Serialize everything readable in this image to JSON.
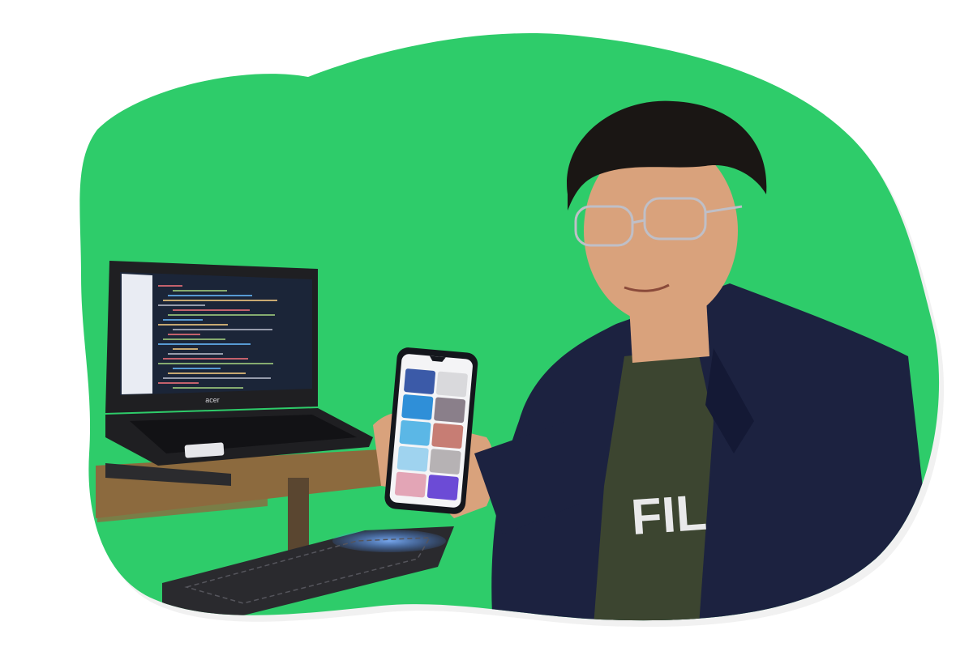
{
  "scene": {
    "background_color": "#ffffff",
    "blob_color": "#2ecc6a",
    "blob_shadow_color": "#c9c9c9"
  },
  "laptop": {
    "brand_text": "acer",
    "body_color": "#1f1f22",
    "screen_color": "#24304a",
    "editor_bg": "#1b2538",
    "code_colors": [
      "#e06c75",
      "#98c379",
      "#61afef",
      "#e5c07b",
      "#abb2bf"
    ]
  },
  "phone": {
    "frame_color": "#14161c",
    "screen_bg": "#f4f4f6",
    "gallery_tile_colors": [
      "#3b5aa8",
      "#d9d9dc",
      "#2f8fd8",
      "#8a7f8a",
      "#5bb7e6",
      "#c77d74",
      "#9fd3ef",
      "#b6b2b4",
      "#e3a5b6",
      "#6c4bd6"
    ]
  },
  "person": {
    "jacket_color": "#1c2240",
    "tshirt_color": "#3c4530",
    "tshirt_logo_text": "FIL",
    "skin_color": "#d9a27c",
    "hair_color": "#1a1614",
    "glasses_color": "#bfbfc7"
  },
  "keyboard": {
    "body_color": "#2a2a2e",
    "backlight_color": "#3e8cff"
  },
  "desk": {
    "shelf_color": "#8c6a3e",
    "leg_color": "#5a4630"
  }
}
